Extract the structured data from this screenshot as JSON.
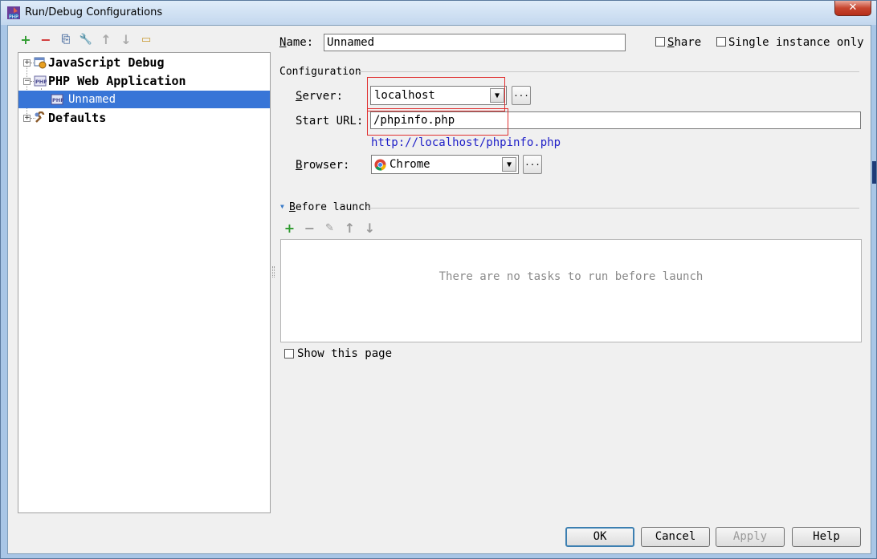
{
  "window": {
    "title": "Run/Debug Configurations",
    "close_label": "✕"
  },
  "left_toolbar": [
    {
      "name": "add-icon",
      "glyph": "+",
      "color": "#2e9b2e"
    },
    {
      "name": "remove-icon",
      "glyph": "−",
      "color": "#d03030"
    },
    {
      "name": "copy-icon",
      "glyph": "⎘",
      "color": "#5a7aa8"
    },
    {
      "name": "edit-defaults-icon",
      "glyph": "🔧",
      "color": "#a06a2a"
    },
    {
      "name": "move-up-icon",
      "glyph": "↑",
      "color": "#aaaaaa"
    },
    {
      "name": "move-down-icon",
      "glyph": "↓",
      "color": "#aaaaaa"
    },
    {
      "name": "folder-icon",
      "glyph": "▭",
      "color": "#c8982e"
    }
  ],
  "tree": {
    "items": [
      {
        "label": "JavaScript Debug",
        "expander": "+"
      },
      {
        "label": "PHP Web Application",
        "expander": "−"
      },
      {
        "label": "Unnamed"
      },
      {
        "label": "Defaults",
        "expander": "+"
      }
    ]
  },
  "form": {
    "name_label": "Name:",
    "name_value": "Unnamed",
    "share_label": "Share",
    "single_instance_label": "Single instance only",
    "configuration_title": "Configuration",
    "server_label": "Server:",
    "server_value": "localhost",
    "start_url_label": "Start URL:",
    "start_url_value": "/phpinfo.php",
    "resolved_url": "http://localhost/phpinfo.php",
    "browser_label": "Browser:",
    "browser_value": "Chrome",
    "dots_label": "..."
  },
  "before_launch": {
    "title": "Before launch",
    "empty_text": "There are no tasks to run before launch",
    "show_page_label": "Show this page"
  },
  "buttons": {
    "ok": "OK",
    "cancel": "Cancel",
    "apply": "Apply",
    "help": "Help"
  }
}
